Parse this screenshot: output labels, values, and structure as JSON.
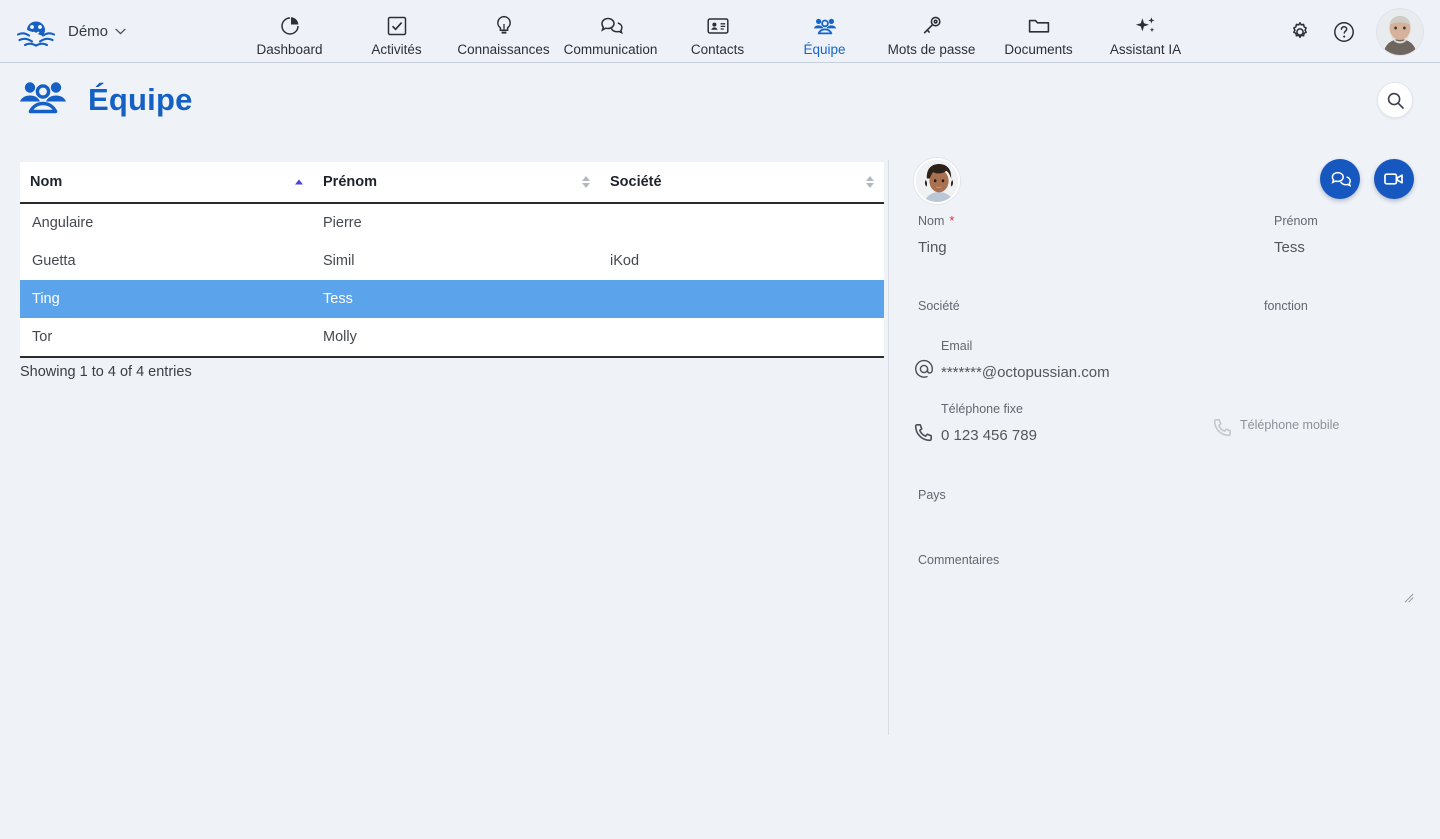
{
  "topbar": {
    "logo_icon": "octopus-logo-icon",
    "tenant_label": "Démo",
    "tenant_caret_icon": "chevron-down-icon",
    "nav": [
      {
        "label": "Dashboard",
        "icon": "pie-chart-icon",
        "active": false
      },
      {
        "label": "Activités",
        "icon": "check-square-icon",
        "active": false
      },
      {
        "label": "Connaissances",
        "icon": "lightbulb-icon",
        "active": false
      },
      {
        "label": "Communication",
        "icon": "chat-bubbles-icon",
        "active": false
      },
      {
        "label": "Contacts",
        "icon": "id-card-icon",
        "active": false
      },
      {
        "label": "Équipe",
        "icon": "people-group-icon",
        "active": true
      },
      {
        "label": "Mots de passe",
        "icon": "key-icon",
        "active": false
      },
      {
        "label": "Documents",
        "icon": "folder-icon",
        "active": false
      },
      {
        "label": "Assistant IA",
        "icon": "sparkles-icon",
        "active": false
      }
    ],
    "settings_icon": "gear-icon",
    "help_icon": "question-circle-icon",
    "avatar_icon": "user-avatar"
  },
  "page": {
    "title": "Équipe",
    "title_icon": "people-group-icon",
    "title_color": "#1560c4",
    "search_icon": "search-icon"
  },
  "table": {
    "columns": [
      {
        "label": "Nom",
        "sort": "asc"
      },
      {
        "label": "Prénom",
        "sort": "none"
      },
      {
        "label": "Société",
        "sort": "none"
      }
    ],
    "rows": [
      {
        "nom": "Angulaire",
        "prenom": "Pierre",
        "societe": "",
        "selected": false
      },
      {
        "nom": "Guetta",
        "prenom": "Simil",
        "societe": "iKod",
        "selected": false
      },
      {
        "nom": "Ting",
        "prenom": "Tess",
        "societe": "",
        "selected": true
      },
      {
        "nom": "Tor",
        "prenom": "Molly",
        "societe": "",
        "selected": false
      }
    ],
    "info": "Showing 1 to 4 of 4 entries",
    "selected_row_color": "#5ba4ec"
  },
  "detail": {
    "avatar_icon": "contact-photo",
    "actions": [
      {
        "name": "chat-button",
        "icon": "chat-bubbles-icon"
      },
      {
        "name": "video-button",
        "icon": "video-camera-icon"
      }
    ],
    "action_color": "#1758c0",
    "fields": {
      "nom": {
        "label": "Nom",
        "required_marker": "*",
        "value": "Ting"
      },
      "prenom": {
        "label": "Prénom",
        "value": "Tess"
      },
      "societe": {
        "label": "Société",
        "value": ""
      },
      "fonction": {
        "label": "fonction",
        "value": ""
      },
      "email": {
        "label": "Email",
        "value": "*******@octopussian.com",
        "icon": "at-sign-icon"
      },
      "tel_fixe": {
        "label": "Téléphone fixe",
        "value": "0 123 456 789",
        "icon": "phone-icon"
      },
      "tel_mobile": {
        "label": "Téléphone mobile",
        "value": "",
        "icon": "phone-icon"
      },
      "pays": {
        "label": "Pays",
        "value": ""
      },
      "commentaires": {
        "label": "Commentaires",
        "value": ""
      }
    }
  }
}
